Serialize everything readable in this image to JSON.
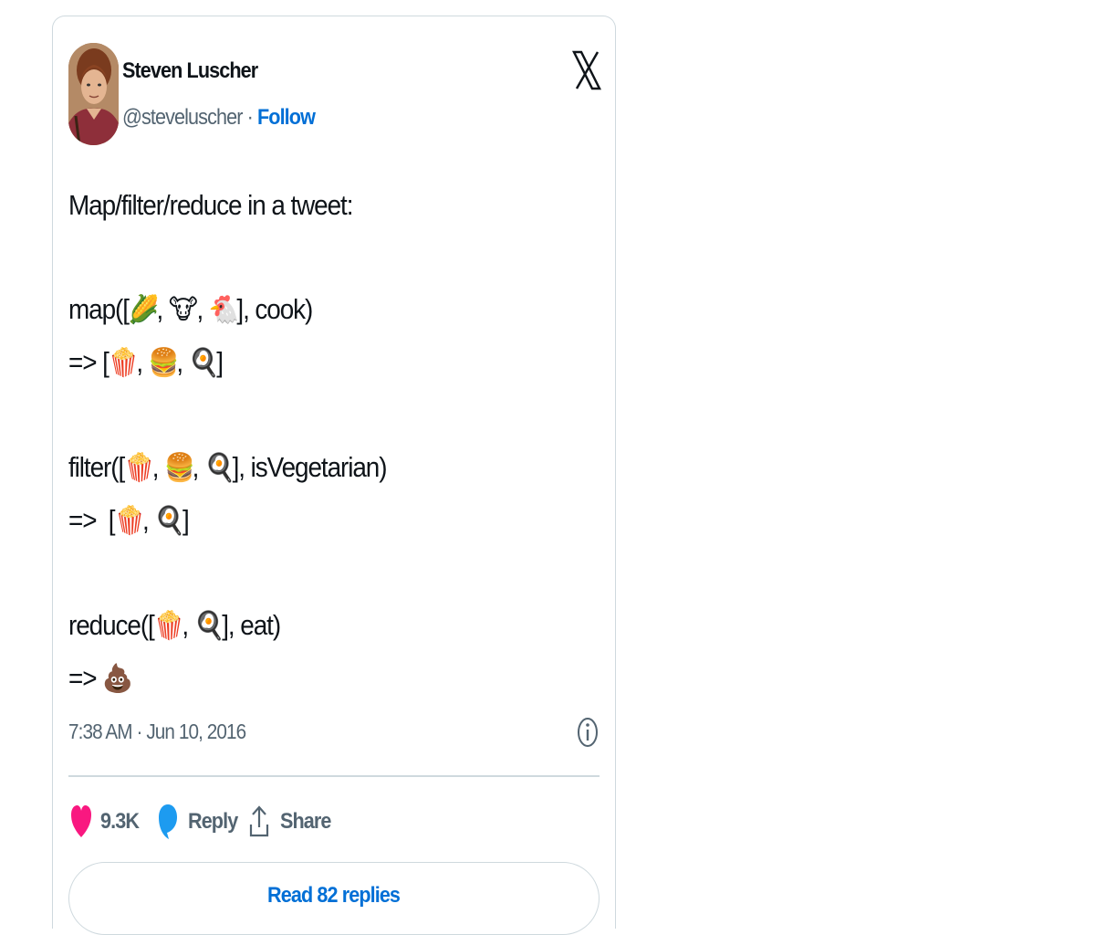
{
  "author": {
    "name": "Steven Luscher",
    "handle": "@steveluscher",
    "separator": " · ",
    "follow_label": "Follow"
  },
  "tweet": {
    "lines": [
      {
        "kind": "text",
        "parts": [
          {
            "t": "Map/filter/reduce in a tweet:"
          }
        ]
      },
      {
        "kind": "blank"
      },
      {
        "kind": "text",
        "parts": [
          {
            "t": "map(["
          },
          {
            "e": "🌽"
          },
          {
            "t": ", "
          },
          {
            "e": "🐮"
          },
          {
            "t": ", "
          },
          {
            "e": "🐔"
          },
          {
            "t": "], cook)"
          }
        ]
      },
      {
        "kind": "text",
        "parts": [
          {
            "t": "=> ["
          },
          {
            "e": "🍿"
          },
          {
            "t": ", "
          },
          {
            "e": "🍔"
          },
          {
            "t": ", "
          },
          {
            "e": "🍳"
          },
          {
            "t": "]"
          }
        ]
      },
      {
        "kind": "blank"
      },
      {
        "kind": "text",
        "parts": [
          {
            "t": "filter(["
          },
          {
            "e": "🍿"
          },
          {
            "t": ", "
          },
          {
            "e": "🍔"
          },
          {
            "t": ", "
          },
          {
            "e": "🍳"
          },
          {
            "t": "], isVegetarian)"
          }
        ]
      },
      {
        "kind": "text",
        "parts": [
          {
            "t": "=>  ["
          },
          {
            "e": "🍿"
          },
          {
            "t": ", "
          },
          {
            "e": "🍳"
          },
          {
            "t": "]"
          }
        ]
      },
      {
        "kind": "blank"
      },
      {
        "kind": "text",
        "parts": [
          {
            "t": "reduce(["
          },
          {
            "e": "🍿"
          },
          {
            "t": ", "
          },
          {
            "e": "🍳"
          },
          {
            "t": "], eat)"
          }
        ]
      },
      {
        "kind": "text",
        "parts": [
          {
            "t": "=> "
          },
          {
            "e": "💩"
          }
        ]
      }
    ]
  },
  "timestamp": "7:38 AM · Jun 10, 2016",
  "actions": {
    "like_count": "9.3K",
    "reply_label": "Reply",
    "share_label": "Share"
  },
  "read_replies_label": "Read 82 replies",
  "icons": {
    "logo": "x-logo-icon",
    "info": "info-icon",
    "like": "heart-icon",
    "reply": "speech-bubble-icon",
    "share": "share-arrow-icon"
  },
  "colors": {
    "like": "#f91880",
    "reply": "#1d9bf0",
    "link": "#006fd6",
    "muted": "#536471",
    "border": "#cfd9de"
  }
}
